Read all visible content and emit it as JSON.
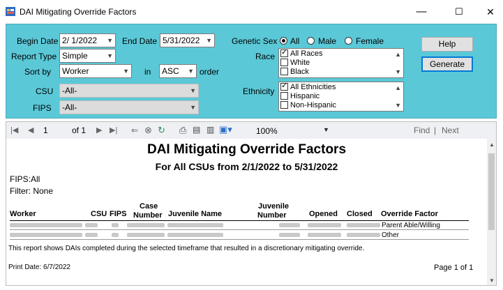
{
  "window": {
    "title": "DAI Mitigating Override Factors",
    "minimize": "—",
    "maximize": "☐",
    "close": "✕"
  },
  "filters": {
    "begin_date_label": "Begin Date",
    "begin_date": "2/ 1/2022",
    "end_date_label": "End Date",
    "end_date": "5/31/2022",
    "report_type_label": "Report Type",
    "report_type": "Simple",
    "sort_by_label": "Sort by",
    "sort_by": "Worker",
    "in_label": "in",
    "order_dir": "ASC",
    "order_label": "order",
    "csu_label": "CSU",
    "csu": "-All-",
    "fips_label": "FIPS",
    "fips": "-All-",
    "genetic_sex_label": "Genetic Sex",
    "sex_options": [
      "All",
      "Male",
      "Female"
    ],
    "sex_selected": "All",
    "race_label": "Race",
    "race_items": [
      "All Races",
      "White",
      "Black"
    ],
    "ethnicity_label": "Ethnicity",
    "ethnicity_items": [
      "All Ethnicities",
      "Hispanic",
      "Non-Hispanic"
    ],
    "help_button": "Help",
    "generate_button": "Generate"
  },
  "toolbar": {
    "page_current": "1",
    "page_of": "of 1",
    "zoom": "100%",
    "find": "Find",
    "separator": "|",
    "next": "Next"
  },
  "report": {
    "title": "DAI Mitigating Override Factors",
    "subtitle": "For All CSUs  from  2/1/2022  to  5/31/2022",
    "fips_line": "FIPS:All",
    "filter_line": "Filter: None",
    "columns": {
      "worker": "Worker",
      "csu": "CSU",
      "fips": "FIPS",
      "case_number_1": "Case",
      "case_number_2": "Number",
      "juvenile_name": "Juvenile Name",
      "juvenile_number_1": "Juvenile",
      "juvenile_number_2": "Number",
      "opened": "Opened",
      "closed": "Closed",
      "override_factor": "Override Factor"
    },
    "rows": [
      {
        "override_factor": "Parent Able/Willing"
      },
      {
        "override_factor": "Other"
      }
    ],
    "footnote": "This report shows DAIs completed during the selected timeframe that resulted in a discretionary mitigating override.",
    "print_date": "Print Date: 6/7/2022",
    "page_label": "Page 1 of 1"
  },
  "colors": {
    "panel": "#5bc8d7",
    "accent": "#0078d7"
  }
}
